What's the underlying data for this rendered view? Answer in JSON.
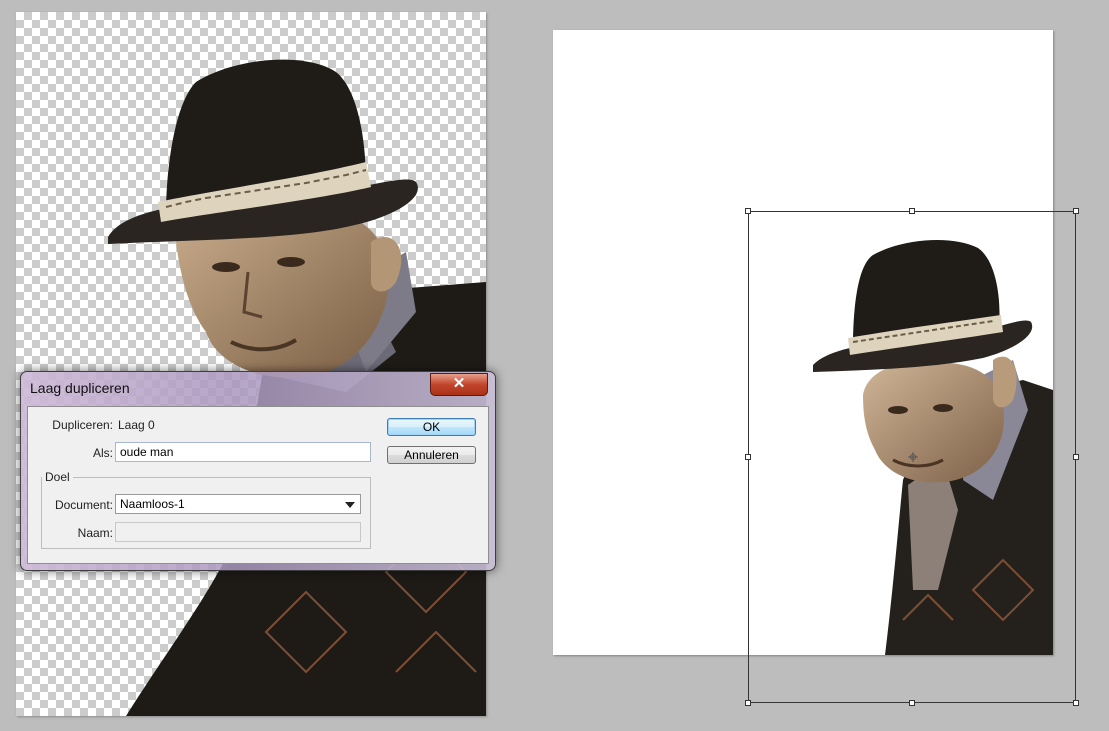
{
  "dialog": {
    "title": "Laag dupliceren",
    "close_label": "✕",
    "duplicate_label": "Dupliceren:",
    "duplicate_value": "Laag 0",
    "as_label": "Als:",
    "as_value": "oude man",
    "group_label": "Doel",
    "document_label": "Document:",
    "document_value": "Naamloos-1",
    "name_label": "Naam:",
    "name_value": "",
    "ok_label": "OK",
    "cancel_label": "Annuleren"
  },
  "colors": {
    "workspace": "#bdbdbd",
    "close_button": "#c2452b",
    "ok_button": "#a7d9f5"
  },
  "icons": {
    "close": "close-icon",
    "dropdown": "chevron-down-icon",
    "transform_center": "crosshair-icon"
  }
}
